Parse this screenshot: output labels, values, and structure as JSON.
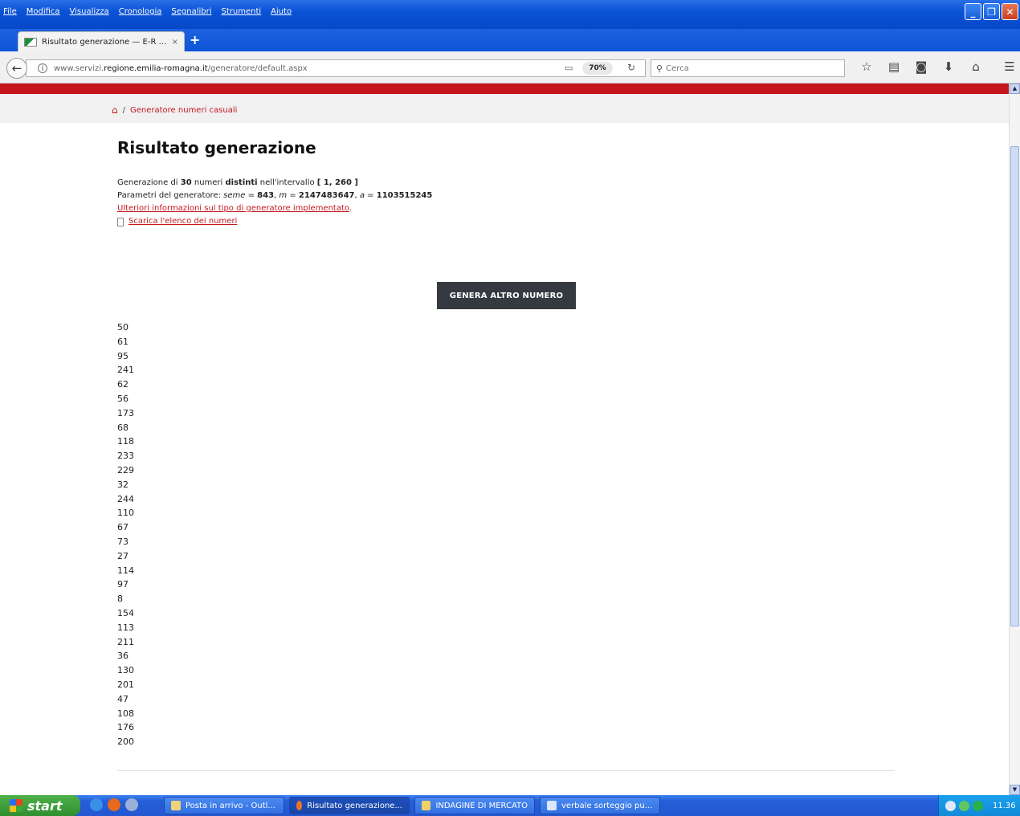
{
  "menubar": {
    "items": [
      "File",
      "Modifica",
      "Visualizza",
      "Cronologia",
      "Segnalibri",
      "Strumenti",
      "Aiuto"
    ]
  },
  "tab": {
    "title": "Risultato generazione — E-R ...",
    "close": "×"
  },
  "newtab": "+",
  "navbar": {
    "url_prefix": "www.servizi.",
    "url_domain": "regione.emilia-romagna.it",
    "url_path": "/generatore/default.aspx",
    "zoom": "70%",
    "search_placeholder": "Cerca"
  },
  "breadcrumb": {
    "sep": "/",
    "label": "Generatore numeri casuali"
  },
  "page": {
    "title": "Risultato generazione",
    "l1_a": "Generazione di ",
    "l1_count": "30",
    "l1_b": " numeri ",
    "l1_distinct": "distinti",
    "l1_c": " nell'intervallo ",
    "l1_range": "[ 1, 260 ]",
    "l2_a": "Parametri del generatore: ",
    "l2_seed_label": "seme",
    "l2_seed": "843",
    "l2_m_label": "m",
    "l2_m": "2147483647",
    "l2_a_label": "a",
    "l2_a_val": "1103515245",
    "eq": " = ",
    "comma": ", ",
    "info_link": "Ulteriori informazioni sul tipo di generatore implementato",
    "period": ".",
    "download_link": "Scarica l'elenco dei numeri",
    "button": "GENERA ALTRO NUMERO"
  },
  "numbers": [
    "50",
    "61",
    "95",
    "241",
    "62",
    "56",
    "173",
    "68",
    "118",
    "233",
    "229",
    "32",
    "244",
    "110",
    "67",
    "73",
    "27",
    "114",
    "97",
    "8",
    "154",
    "113",
    "211",
    "36",
    "130",
    "201",
    "47",
    "108",
    "176",
    "200"
  ],
  "taskbar": {
    "start": "start",
    "items": [
      "Posta in arrivo - Outl...",
      "Risultato generazione...",
      "INDAGINE DI MERCATO",
      "verbale sorteggio pu..."
    ],
    "clock": "11.36"
  },
  "colors": {
    "brand_red": "#c4161c",
    "button_dark": "#343a40",
    "xp_blue": "#245ed8"
  }
}
